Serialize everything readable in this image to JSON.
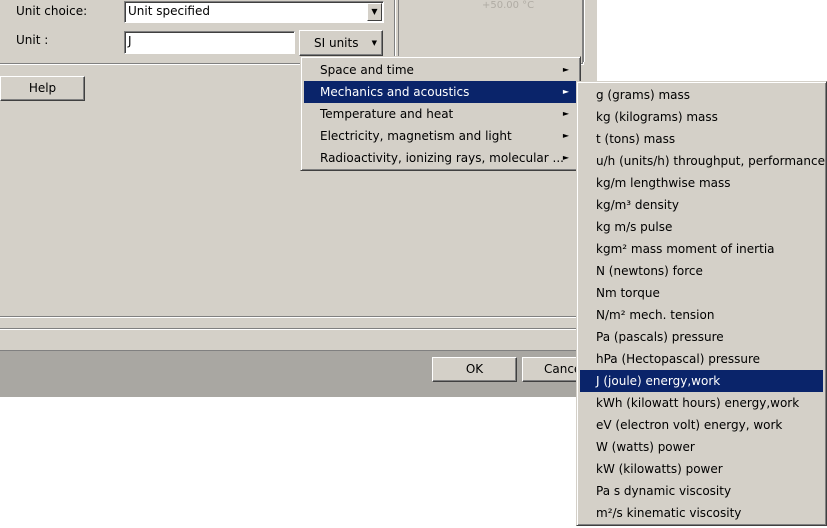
{
  "dialog": {
    "unit_choice_label": "Unit choice:",
    "unit_choice_value": "Unit specified",
    "unit_label": "Unit :",
    "unit_value": "J",
    "si_units_label": "SI units",
    "help_label": "Help",
    "ok_label": "OK",
    "cancel_label": "Cance",
    "faded_text": "+50.00 °C"
  },
  "menu": {
    "items": [
      {
        "label": "Space and time"
      },
      {
        "label": "Mechanics and acoustics",
        "selected": true
      },
      {
        "label": "Temperature and heat"
      },
      {
        "label": "Electricity, magnetism and light"
      },
      {
        "label": "Radioactivity, ionizing rays, molecular ..."
      }
    ]
  },
  "submenu": {
    "items": [
      {
        "label": "g (grams) mass"
      },
      {
        "label": "kg (kilograms) mass"
      },
      {
        "label": "t (tons) mass"
      },
      {
        "label": "u/h (units/h) throughput, performance"
      },
      {
        "label": "kg/m lengthwise mass"
      },
      {
        "label": "kg/m³ density"
      },
      {
        "label": "kg m/s pulse"
      },
      {
        "label": "kgm² mass moment of inertia"
      },
      {
        "label": "N (newtons) force"
      },
      {
        "label": "Nm torque"
      },
      {
        "label": "N/m² mech. tension"
      },
      {
        "label": "Pa (pascals) pressure"
      },
      {
        "label": "hPa (Hectopascal) pressure"
      },
      {
        "label": "J (joule) energy,work",
        "selected": true
      },
      {
        "label": "kWh (kilowatt hours) energy,work"
      },
      {
        "label": "eV (electron volt) energy, work"
      },
      {
        "label": "W (watts) power"
      },
      {
        "label": "kW (kilowatts) power"
      },
      {
        "label": "Pa s dynamic viscosity"
      },
      {
        "label": "m²/s kinematic viscosity"
      }
    ]
  },
  "icons": {
    "dropdown_arrow": "▼",
    "submenu_arrow": "►"
  }
}
